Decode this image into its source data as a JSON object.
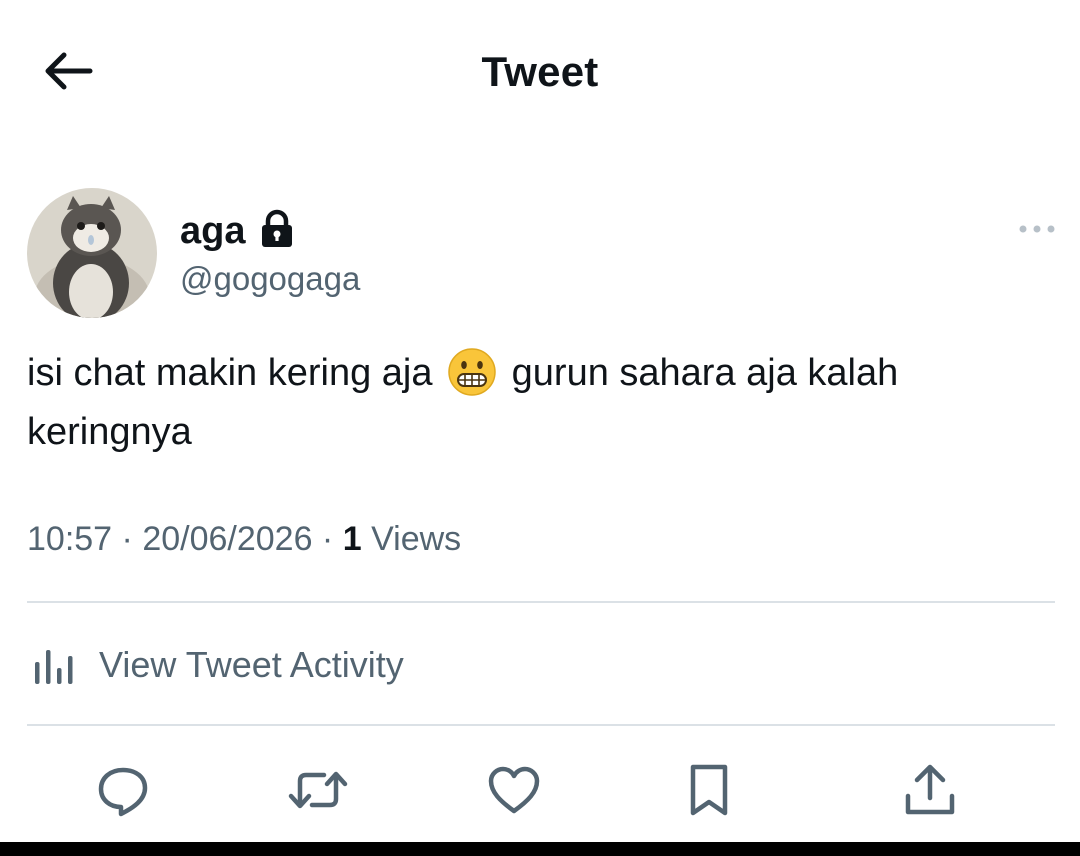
{
  "header": {
    "title": "Tweet"
  },
  "author": {
    "name": "aga",
    "handle": "@gogogaga",
    "locked": true
  },
  "tweet": {
    "text_part1": "isi chat makin kering aja",
    "emoji": "grimacing-face",
    "text_part2": "gurun sahara aja kalah keringnya"
  },
  "meta": {
    "time": "10:57",
    "separator1": " · ",
    "date": "20/06/2026",
    "separator2": " · ",
    "views_count": "1",
    "views_label": "Views"
  },
  "activity": {
    "label": "View Tweet Activity"
  },
  "icons": {
    "back": "arrow-left-icon",
    "lock": "lock-icon",
    "more": "more-horizontal-icon",
    "analytics": "bar-chart-icon",
    "reply": "reply-icon",
    "retweet": "retweet-icon",
    "like": "heart-icon",
    "bookmark": "bookmark-icon",
    "share": "share-icon"
  },
  "colors": {
    "text": "#0f1419",
    "secondary": "#536471",
    "divider": "#dbe1e6"
  }
}
